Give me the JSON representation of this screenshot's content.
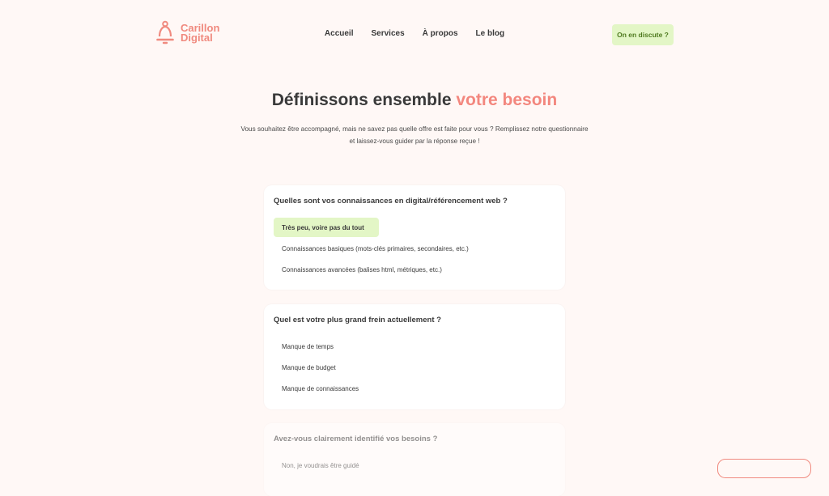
{
  "brand": {
    "name_line1": "Carillon",
    "name_line2": "Digital",
    "accent": "#f08a7f",
    "cta_bg": "#e3f6c6"
  },
  "nav": {
    "items": [
      {
        "label": "Accueil"
      },
      {
        "label": "Services"
      },
      {
        "label": "À propos"
      },
      {
        "label": "Le blog"
      }
    ]
  },
  "header": {
    "cta_label": "On en discute ?"
  },
  "hero": {
    "title_main": "Définissons ensemble ",
    "title_accent": "votre besoin",
    "subtitle_line1": "Vous souhaitez être accompagné, mais ne savez pas quelle offre est faite pour vous ? Remplissez notre questionnaire",
    "subtitle_line2": "et laissez-vous guider par la réponse reçue !"
  },
  "questions": [
    {
      "title": "Quelles sont vos connaissances en digital/référencement web ?",
      "options": [
        {
          "label": "Très peu, voire pas du tout",
          "selected": true
        },
        {
          "label": "Connaissances basiques (mots-clés primaires, secondaires, etc.)",
          "selected": false
        },
        {
          "label": "Connaissances avancées (balises html, métriques, etc.)",
          "selected": false
        }
      ]
    },
    {
      "title": "Quel est votre plus grand frein actuellement ?",
      "options": [
        {
          "label": "Manque de temps",
          "selected": false
        },
        {
          "label": "Manque de budget",
          "selected": false
        },
        {
          "label": "Manque de connaissances",
          "selected": false
        }
      ]
    },
    {
      "title": "Avez-vous clairement identifié vos besoins ?",
      "options": [
        {
          "label": "Non, je voudrais être guidé",
          "selected": false
        }
      ]
    }
  ]
}
